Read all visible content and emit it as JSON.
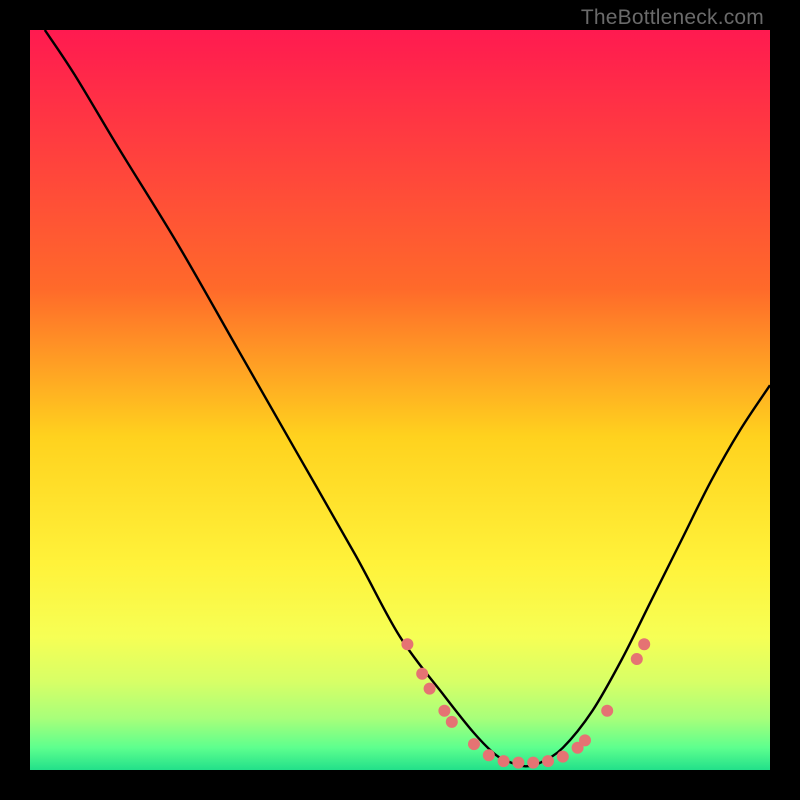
{
  "watermark": "TheBottleneck.com",
  "chart_data": {
    "type": "line",
    "title": "",
    "xlabel": "",
    "ylabel": "",
    "xlim": [
      0,
      100
    ],
    "ylim": [
      0,
      100
    ],
    "grid": false,
    "legend": false,
    "gradient_stops": [
      {
        "offset": 0,
        "color": "#ff1a50"
      },
      {
        "offset": 35,
        "color": "#ff6a2a"
      },
      {
        "offset": 55,
        "color": "#ffd21e"
      },
      {
        "offset": 72,
        "color": "#fff23a"
      },
      {
        "offset": 82,
        "color": "#f6ff55"
      },
      {
        "offset": 88,
        "color": "#d8ff66"
      },
      {
        "offset": 93,
        "color": "#a8ff7a"
      },
      {
        "offset": 97,
        "color": "#5dff8e"
      },
      {
        "offset": 100,
        "color": "#22e08a"
      }
    ],
    "series": [
      {
        "name": "bottleneck-curve",
        "color": "#000000",
        "x": [
          2,
          6,
          12,
          20,
          28,
          36,
          44,
          50,
          56,
          60,
          63,
          65,
          67,
          69,
          72,
          76,
          80,
          84,
          88,
          92,
          96,
          100
        ],
        "y": [
          100,
          94,
          84,
          71,
          57,
          43,
          29,
          18,
          10,
          5,
          2,
          1,
          0.5,
          1,
          3,
          8,
          15,
          23,
          31,
          39,
          46,
          52
        ]
      }
    ],
    "scatter": {
      "name": "highlighted-points",
      "color": "#e57373",
      "radius": 6,
      "points": [
        {
          "x": 51,
          "y": 17
        },
        {
          "x": 53,
          "y": 13
        },
        {
          "x": 54,
          "y": 11
        },
        {
          "x": 56,
          "y": 8
        },
        {
          "x": 57,
          "y": 6.5
        },
        {
          "x": 60,
          "y": 3.5
        },
        {
          "x": 62,
          "y": 2
        },
        {
          "x": 64,
          "y": 1.2
        },
        {
          "x": 66,
          "y": 1
        },
        {
          "x": 68,
          "y": 1
        },
        {
          "x": 70,
          "y": 1.2
        },
        {
          "x": 72,
          "y": 1.8
        },
        {
          "x": 74,
          "y": 3
        },
        {
          "x": 75,
          "y": 4
        },
        {
          "x": 78,
          "y": 8
        },
        {
          "x": 82,
          "y": 15
        },
        {
          "x": 83,
          "y": 17
        }
      ]
    }
  }
}
